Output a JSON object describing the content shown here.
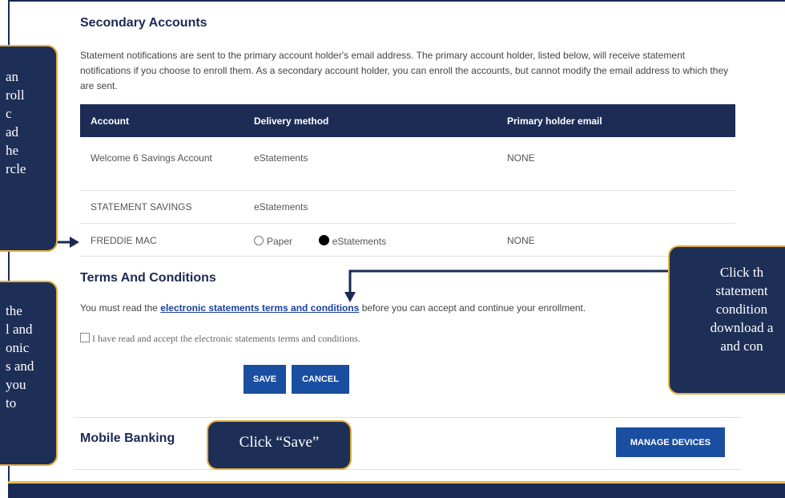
{
  "secondary": {
    "title": "Secondary Accounts",
    "intro": "Statement notifications are sent to the primary account holder's email address. The primary account holder, listed below, will receive statement notifications if you choose to enroll them. As a secondary account holder, you can enroll the accounts, but cannot modify the email address to which they are sent."
  },
  "table": {
    "headers": [
      "Account",
      "Delivery method",
      "Primary holder email"
    ],
    "rows": [
      {
        "account": "Welcome 6 Savings Account",
        "delivery": "eStatements",
        "email": "NONE"
      },
      {
        "account": "STATEMENT SAVINGS",
        "delivery": "eStatements",
        "email": ""
      },
      {
        "account": "FREDDIE MAC",
        "paper": "Paper",
        "estatements": "eStatements",
        "selected": "eStatements",
        "email": "NONE"
      }
    ]
  },
  "terms": {
    "title": "Terms And Conditions",
    "before": "You must read the ",
    "link": "electronic statements terms and conditions",
    "after": " before you can accept and continue your enrollment.",
    "checkbox": "I have read and accept the electronic statements terms and conditions."
  },
  "buttons": {
    "save": "SAVE",
    "cancel": "CANCEL",
    "manage": "MANAGE DEVICES"
  },
  "mobile": {
    "title": "Mobile Banking"
  },
  "callouts": {
    "left_top": [
      "an",
      "roll",
      "c",
      "ad",
      "he",
      "rcle"
    ],
    "left_bottom": [
      "the",
      "l and",
      "onic",
      "s and",
      "you",
      "to"
    ],
    "right": [
      "Click th",
      "statement",
      "condition",
      "download a",
      "and con"
    ],
    "save": "Click “Save”"
  },
  "colors": {
    "navy": "#1b2a55",
    "button": "#1a4ea0",
    "gold": "#e3b13c"
  }
}
